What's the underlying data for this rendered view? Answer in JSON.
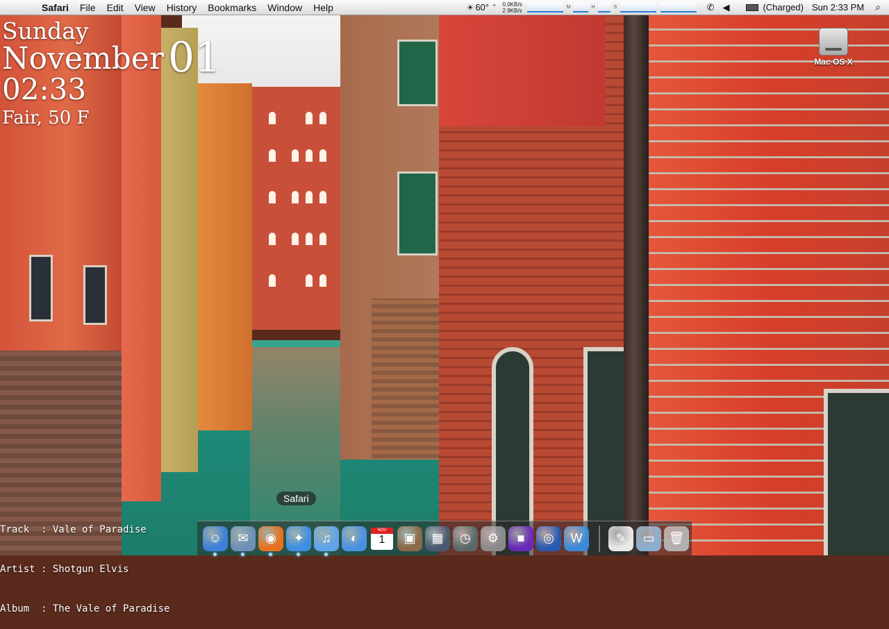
{
  "menubar": {
    "apple_glyph": "",
    "app_name": "Safari",
    "menus": [
      "File",
      "Edit",
      "View",
      "History",
      "Bookmarks",
      "Window",
      "Help"
    ],
    "status": {
      "temperature": "60°",
      "net_down": "0.0KB/s",
      "net_up": "2.9KB/s",
      "battery_text": "(Charged)",
      "clock": "Sun 2:33 PM",
      "spotlight_glyph": "⌕"
    }
  },
  "desktop_widget": {
    "day": "Sunday",
    "month": "November",
    "date": "01",
    "time": "02:33",
    "weather": "Fair, 50 F"
  },
  "now_playing": {
    "track_line": "Track  : Vale of Paradise",
    "artist_line": "Artist : Shotgun Elvis",
    "album_line": "Album  : The Vale of Paradise"
  },
  "desktop_icons": {
    "disk_label": "Mac OS X"
  },
  "dock": {
    "tooltip": "Safari",
    "calendar_month": "NOV",
    "calendar_day": "1",
    "apps": [
      {
        "name": "finder",
        "glyph": "☺",
        "color": "#3d7fd9",
        "running": true
      },
      {
        "name": "mail",
        "glyph": "✉",
        "color": "#6d8fb8",
        "running": true
      },
      {
        "name": "firefox",
        "glyph": "◉",
        "color": "#e8701e",
        "running": true
      },
      {
        "name": "safari",
        "glyph": "✦",
        "color": "#3e8fe0",
        "running": true
      },
      {
        "name": "itunes",
        "glyph": "♫",
        "color": "#5fa3e8",
        "running": true
      },
      {
        "name": "ichat",
        "glyph": "◐",
        "color": "#4a90e2",
        "running": false
      },
      {
        "name": "ical",
        "glyph": "",
        "color": "#ffffff",
        "running": false
      },
      {
        "name": "iphoto",
        "glyph": "▣",
        "color": "#8a6a4a",
        "running": false
      },
      {
        "name": "dashboard",
        "glyph": "▦",
        "color": "#4a5a70",
        "running": false
      },
      {
        "name": "time-machine",
        "glyph": "◷",
        "color": "#5a6a6a",
        "running": false
      },
      {
        "name": "system-preferences",
        "glyph": "⚙",
        "color": "#8a8a8a",
        "running": false
      },
      {
        "name": "purple-app",
        "glyph": "■",
        "color": "#6a2ab8",
        "running": false
      },
      {
        "name": "disc-utility",
        "glyph": "◎",
        "color": "#2a5ab0",
        "running": false
      },
      {
        "name": "word-app",
        "glyph": "W",
        "color": "#3a8ad8",
        "running": false
      }
    ],
    "right_items": [
      {
        "name": "documents-stack",
        "glyph": "✎",
        "color": "#e8e8e8"
      },
      {
        "name": "downloads-folder",
        "glyph": "▭",
        "color": "#8aaed0"
      },
      {
        "name": "trash",
        "glyph": "🗑",
        "color": "#b0b0b0"
      }
    ]
  }
}
